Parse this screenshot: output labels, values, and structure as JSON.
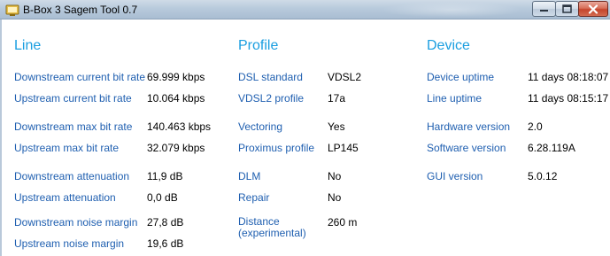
{
  "window": {
    "title": "B-Box 3 Sagem Tool 0.7"
  },
  "colors": {
    "section_title": "#1a9ee0",
    "label": "#1f5fb0",
    "value": "#000000"
  },
  "line": {
    "title": "Line",
    "rows": [
      {
        "label": "Downstream current bit rate",
        "value": "69.999 kbps"
      },
      {
        "label": "Upstream current bit rate",
        "value": "10.064 kbps"
      },
      {
        "label": "Downstream max bit rate",
        "value": "140.463 kbps"
      },
      {
        "label": "Upstream max bit rate",
        "value": "32.079 kbps"
      },
      {
        "label": "Downstream attenuation",
        "value": "11,9 dB"
      },
      {
        "label": "Upstream attenuation",
        "value": "0,0 dB"
      },
      {
        "label": "Downstream noise margin",
        "value": "27,8 dB"
      },
      {
        "label": "Upstream noise margin",
        "value": "19,6 dB"
      }
    ]
  },
  "profile": {
    "title": "Profile",
    "rows": [
      {
        "label": "DSL standard",
        "value": "VDSL2"
      },
      {
        "label": "VDSL2 profile",
        "value": "17a"
      },
      {
        "label": "Vectoring",
        "value": "Yes"
      },
      {
        "label": "Proximus profile",
        "value": "LP145"
      },
      {
        "label": "DLM",
        "value": "No"
      },
      {
        "label": "Repair",
        "value": "No"
      },
      {
        "label_line1": "Distance",
        "label_line2": "(experimental)",
        "value": "260 m"
      }
    ]
  },
  "device": {
    "title": "Device",
    "rows": [
      {
        "label": "Device uptime",
        "value": "11 days 08:18:07"
      },
      {
        "label": "Line uptime",
        "value": "11 days 08:15:17"
      },
      {
        "label": "Hardware version",
        "value": "2.0"
      },
      {
        "label": "Software version",
        "value": "6.28.119A"
      },
      {
        "label": "GUI version",
        "value": "5.0.12"
      }
    ]
  }
}
